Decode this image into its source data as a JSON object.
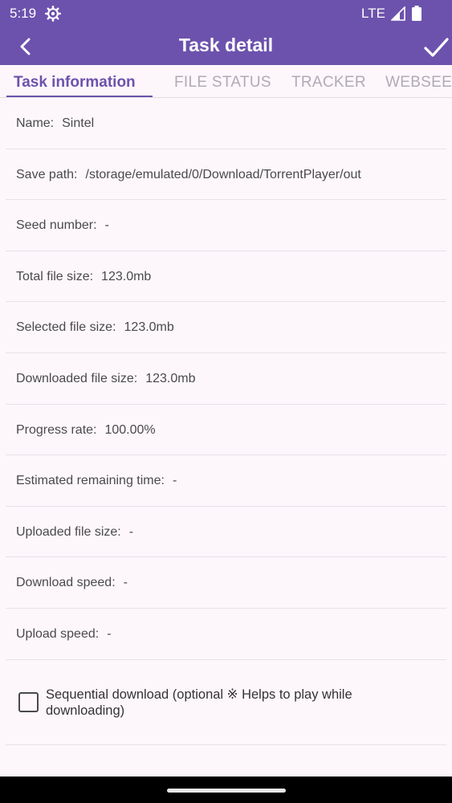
{
  "status_bar": {
    "time": "5:19",
    "network": "LTE",
    "icons": [
      "settings-gear-icon",
      "signal-icon",
      "battery-icon"
    ]
  },
  "app_bar": {
    "title": "Task detail",
    "back_icon": "chevron-left-icon",
    "confirm_icon": "check-icon"
  },
  "tabs": [
    {
      "label": "Task information",
      "active": true
    },
    {
      "label": "FILE STATUS",
      "active": false
    },
    {
      "label": "TRACKER",
      "active": false
    },
    {
      "label": "WEBSEED",
      "active": false
    }
  ],
  "details": [
    {
      "label": "Name:",
      "value": "Sintel"
    },
    {
      "label": "Save path:",
      "value": "/storage/emulated/0/Download/TorrentPlayer/out"
    },
    {
      "label": "Seed number:",
      "value": "-"
    },
    {
      "label": "Total file size:",
      "value": "123.0mb"
    },
    {
      "label": "Selected file size:",
      "value": "123.0mb"
    },
    {
      "label": "Downloaded file size:",
      "value": "123.0mb"
    },
    {
      "label": "Progress rate:",
      "value": "100.00%"
    },
    {
      "label": "Estimated remaining time:",
      "value": "-"
    },
    {
      "label": "Uploaded file size:",
      "value": "-"
    },
    {
      "label": "Download speed:",
      "value": "-"
    },
    {
      "label": "Upload speed:",
      "value": "-"
    }
  ],
  "sequential_download": {
    "label": "Sequential download (optional ※ Helps to play while downloading)",
    "checked": false
  },
  "colors": {
    "primary": "#6c52ad",
    "background": "#fdf7fc",
    "inactive_tab": "#b0aab6"
  }
}
